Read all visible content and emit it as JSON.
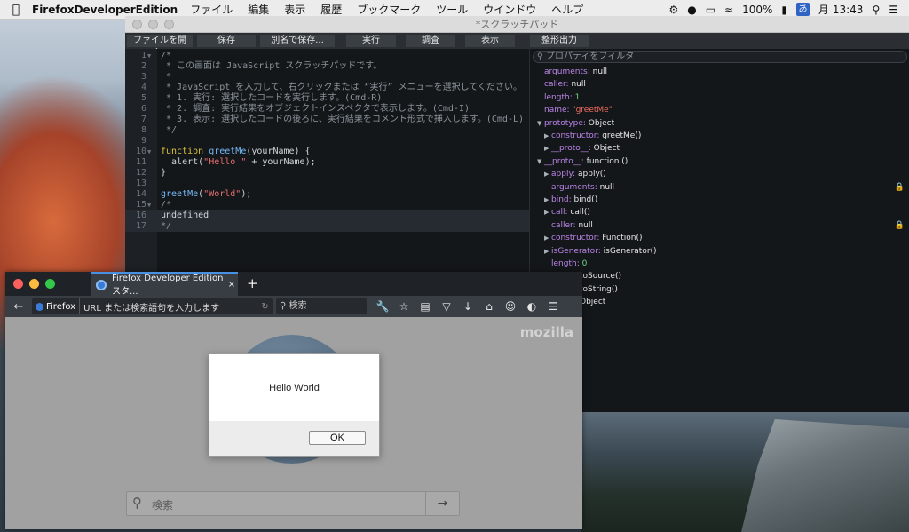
{
  "menubar": {
    "apple": "",
    "app_name": "FirefoxDeveloperEdition",
    "items": [
      "ファイル",
      "編集",
      "表示",
      "履歴",
      "ブックマーク",
      "ツール",
      "ウインドウ",
      "ヘルプ"
    ],
    "battery": "100%",
    "ime": "あ",
    "clock": "月 13:43"
  },
  "scratchpad": {
    "title": "*スクラッチパッド",
    "toolbar": [
      "ファイルを開く...",
      "保存",
      "別名で保存...",
      "実行",
      "調査",
      "表示",
      "整形出力"
    ],
    "filter_placeholder": "プロパティをフィルタ",
    "lines": [
      {
        "n": "1",
        "fold": "▼",
        "text": "/*"
      },
      {
        "n": "2",
        "fold": "",
        "text": " * この画面は JavaScript スクラッチパッドです。"
      },
      {
        "n": "3",
        "fold": "",
        "text": " *"
      },
      {
        "n": "4",
        "fold": "",
        "text": " * JavaScript を入力して、右クリックまたは “実行” メニューを選択してください。"
      },
      {
        "n": "5",
        "fold": "",
        "text": " * 1. 実行: 選択したコードを実行します。(Cmd-R)"
      },
      {
        "n": "6",
        "fold": "",
        "text": " * 2. 調査: 実行結果をオブジェクトインスペクタで表示します。(Cmd-I)"
      },
      {
        "n": "7",
        "fold": "",
        "text": " * 3. 表示: 選択したコードの後ろに、実行結果をコメント形式で挿入します。(Cmd-L)"
      },
      {
        "n": "8",
        "fold": "",
        "text": " */"
      },
      {
        "n": "9",
        "fold": "",
        "text": ""
      },
      {
        "n": "10",
        "fold": "▼",
        "kw": "function",
        "fn": "greetMe",
        "rest": "(yourName) {"
      },
      {
        "n": "11",
        "fold": "",
        "pre": "  alert(",
        "str": "\"Hello \"",
        "post": " + yourName);"
      },
      {
        "n": "12",
        "fold": "",
        "text": "}"
      },
      {
        "n": "13",
        "fold": "",
        "text": ""
      },
      {
        "n": "14",
        "fold": "",
        "fn": "greetMe",
        "rest": "(",
        "str": "\"World\"",
        "post": ");"
      },
      {
        "n": "15",
        "fold": "▼",
        "text": "/*"
      },
      {
        "n": "16",
        "fold": "",
        "text": "undefined"
      },
      {
        "n": "17",
        "fold": "",
        "text": "*/"
      }
    ],
    "vars": [
      {
        "name": "arguments",
        "value": "null",
        "kind": "plain"
      },
      {
        "name": "caller",
        "value": "null",
        "kind": "plain"
      },
      {
        "name": "length",
        "value": "1",
        "kind": "num"
      },
      {
        "name": "name",
        "value": "\"greetMe\"",
        "kind": "str"
      },
      {
        "name": "prototype",
        "value": "Object",
        "kind": "plain"
      },
      {
        "name": "constructor",
        "value": "greetMe()",
        "kind": "plain"
      },
      {
        "name": "__proto__",
        "value": "Object",
        "kind": "plain"
      },
      {
        "name": "__proto__",
        "value": "function ()",
        "kind": "plain"
      },
      {
        "name": "apply",
        "value": "apply()",
        "kind": "plain"
      },
      {
        "name": "arguments",
        "value": "null",
        "kind": "plain"
      },
      {
        "name": "bind",
        "value": "bind()",
        "kind": "plain"
      },
      {
        "name": "call",
        "value": "call()",
        "kind": "plain"
      },
      {
        "name": "caller",
        "value": "null",
        "kind": "plain"
      },
      {
        "name": "constructor",
        "value": "Function()",
        "kind": "plain"
      },
      {
        "name": "isGenerator",
        "value": "isGenerator()",
        "kind": "plain"
      },
      {
        "name": "length",
        "value": "0",
        "kind": "num"
      },
      {
        "name": "",
        "value": "toSource()",
        "kind": "plain"
      },
      {
        "name": "",
        "value": "toString()",
        "kind": "plain"
      },
      {
        "name": "",
        "value": "Object",
        "kind": "plain"
      }
    ]
  },
  "browser": {
    "tab_title": "Firefox Developer Edition スタ...",
    "tab_close": "×",
    "new_tab": "+",
    "identity_label": "Firefox",
    "url_placeholder": "URL または検索語句を入力します",
    "search_placeholder": "検索",
    "brand": "mozilla",
    "home_search_placeholder": "検索"
  },
  "alert": {
    "message": "Hello World",
    "ok": "OK"
  },
  "colors": {
    "accent": "#4a90e2",
    "comment": "#8b949c",
    "keyword": "#dcc23b",
    "function": "#74b7f4",
    "string": "#e26d6d"
  }
}
